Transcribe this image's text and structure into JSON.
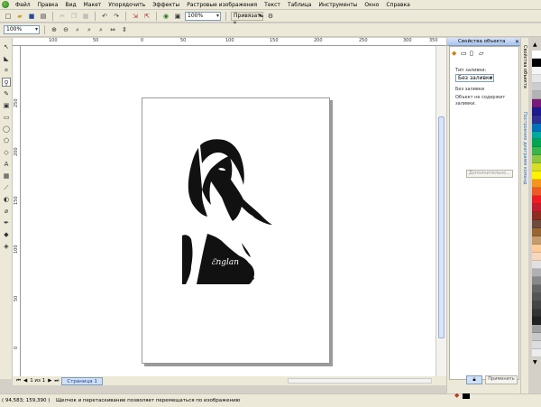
{
  "menu": [
    "Файл",
    "Правка",
    "Вид",
    "Макет",
    "Упорядочить",
    "Эффекты",
    "Растровые изображения",
    "Текст",
    "Таблица",
    "Инструменты",
    "Окно",
    "Справка"
  ],
  "toolbar": {
    "zoom_value": "100%",
    "snap_label": "Привязать к",
    "prop_zoom_value": "100%"
  },
  "ruler": {
    "h_ticks": [
      "100",
      "50",
      "0",
      "50",
      "100",
      "150",
      "200",
      "250",
      "300",
      "350"
    ],
    "v_ticks": [
      "250",
      "200",
      "150",
      "100",
      "50",
      "0"
    ]
  },
  "status": {
    "page_counter": "1 из 1",
    "page_tab": "Страница 1",
    "coords": "( 94,583; 159,390 )",
    "hint": "Щелчок и перетаскивание позволяет перемещаться по изображению"
  },
  "panel": {
    "title": "Свойства объекта",
    "fill_type_label": "Тип заливки:",
    "fill_type_value": "Без заливки",
    "fill_none_label": "Без заливки",
    "fill_desc": "Объект не содержит заливки.",
    "more_button": "Дополнительно...",
    "apply_button": "Применить"
  },
  "sidetabs": [
    "Свойства объекта",
    "Построение диаграмм команд"
  ],
  "palette": [
    "#ffffff",
    "#000000",
    "#f5f5f5",
    "#e6e6e6",
    "#cccccc",
    "#b3b3b3",
    "#7a1a7a",
    "#1f1a8f",
    "#2e3192",
    "#0072bc",
    "#00a99d",
    "#00a651",
    "#39b54a",
    "#8dc63f",
    "#d7df23",
    "#fff200",
    "#f7941d",
    "#f15a24",
    "#ed1c24",
    "#be1e2d",
    "#8b2d1f",
    "#6d4b3e",
    "#996633",
    "#c69c6d",
    "#ffcc99",
    "#f9d6c0",
    "#e0e0e0",
    "#b0b0b0",
    "#888888",
    "#666666",
    "#555555",
    "#444444",
    "#333333",
    "#222222",
    "#a0a0a0",
    "#c8c8c8",
    "#dcdcdc",
    "#ececec"
  ]
}
